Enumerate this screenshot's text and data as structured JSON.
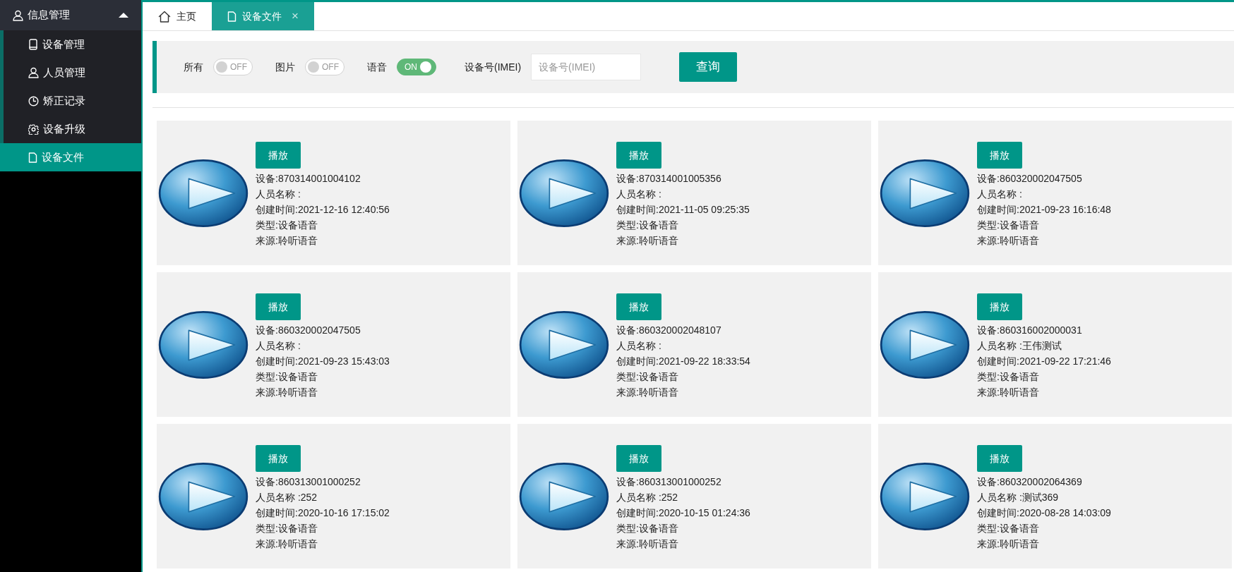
{
  "sidebar": {
    "groups": [
      {
        "label": "信息管理",
        "expanded": true,
        "items": [
          {
            "label": "设备管理",
            "kind": "tablet",
            "selected": false
          },
          {
            "label": "人员管理",
            "kind": "user",
            "selected": false
          },
          {
            "label": "矫正记录",
            "kind": "clock",
            "selected": false
          },
          {
            "label": "设备升级",
            "kind": "gear",
            "selected": false
          },
          {
            "label": "设备文件",
            "kind": "file",
            "selected": true
          }
        ]
      }
    ]
  },
  "tabs": [
    {
      "label": "主页",
      "kind": "home",
      "selected": false
    },
    {
      "label": "设备文件",
      "kind": "file",
      "selected": true,
      "close": "×"
    }
  ],
  "filters": {
    "toggles": [
      {
        "label": "所有",
        "on": false,
        "text": "OFF"
      },
      {
        "label": "图片",
        "on": false,
        "text": "OFF"
      },
      {
        "label": "语音",
        "on": true,
        "text": "ON"
      }
    ],
    "imei": {
      "label": "设备号(IMEI)",
      "placeholder": "设备号(IMEI)"
    },
    "button": "查询"
  },
  "files": [
    {
      "button": "播放",
      "device": "设备:870314001004102",
      "person": "人员名称 :",
      "created": "创建时间:2021-12-16 12:40:56",
      "type": "类型:设备语音",
      "source": "来源:聆听语音"
    },
    {
      "button": "播放",
      "device": "设备:870314001005356",
      "person": "人员名称 :",
      "created": "创建时间:2021-11-05 09:25:35",
      "type": "类型:设备语音",
      "source": "来源:聆听语音"
    },
    {
      "button": "播放",
      "device": "设备:860320002047505",
      "person": "人员名称 :",
      "created": "创建时间:2021-09-23 16:16:48",
      "type": "类型:设备语音",
      "source": "来源:聆听语音"
    },
    {
      "button": "播放",
      "device": "设备:860320002047505",
      "person": "人员名称 :",
      "created": "创建时间:2021-09-23 15:43:03",
      "type": "类型:设备语音",
      "source": "来源:聆听语音"
    },
    {
      "button": "播放",
      "device": "设备:860320002048107",
      "person": "人员名称 :",
      "created": "创建时间:2021-09-22 18:33:54",
      "type": "类型:设备语音",
      "source": "来源:聆听语音"
    },
    {
      "button": "播放",
      "device": "设备:860316002000031",
      "person": "人员名称 :王伟测试",
      "created": "创建时间:2021-09-22 17:21:46",
      "type": "类型:设备语音",
      "source": "来源:聆听语音"
    },
    {
      "button": "播放",
      "device": "设备:860313001000252",
      "person": "人员名称 :252",
      "created": "创建时间:2020-10-16 17:15:02",
      "type": "类型:设备语音",
      "source": "来源:聆听语音"
    },
    {
      "button": "播放",
      "device": "设备:860313001000252",
      "person": "人员名称 :252",
      "created": "创建时间:2020-10-15 01:24:36",
      "type": "类型:设备语音",
      "source": "来源:聆听语音"
    },
    {
      "button": "播放",
      "device": "设备:860320002064369",
      "person": "人员名称 :测试369",
      "created": "创建时间:2020-08-28 14:03:09",
      "type": "类型:设备语音",
      "source": "来源:聆听语音"
    }
  ]
}
